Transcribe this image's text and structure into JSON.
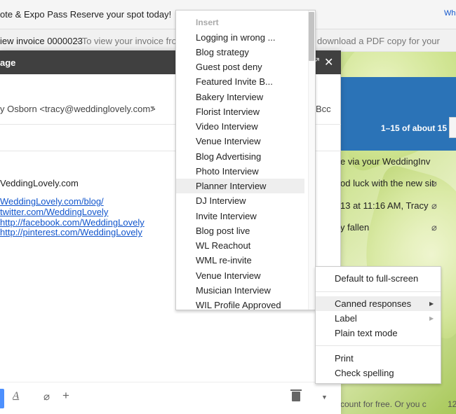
{
  "banner": {
    "text": "ote & Expo Pass Reserve your spot today!",
    "link": "Wh"
  },
  "invoice": {
    "subject": "iew invoice 0000023",
    "snippet": "- To view your invoice fror",
    "snippet_tail": "download a PDF copy for your"
  },
  "inbox": {
    "paging": "1–15 of about 15",
    "rows": [
      "e via your WeddingInv",
      "od luck with the new sit",
      "13 at 11:16 AM, Tracy",
      "y fallen"
    ],
    "bottom_text": "count for free. Or you c",
    "bottom_num": "12"
  },
  "compose": {
    "title": "age",
    "from": "y Osborn <tracy@weddinglovely.com>",
    "bcc": "Bcc",
    "body_line": "VeddingLovely.com",
    "links": [
      "WeddingLovely.com/blog/",
      "twitter.com/WeddingLovely",
      "http://facebook.com/WeddingLovely",
      "http://pinterest.com/WeddingLovely"
    ]
  },
  "insert_menu": {
    "header": "Insert",
    "items": [
      "Logging in wrong ...",
      "Blog strategy",
      "Guest post deny",
      "Featured Invite B...",
      "Bakery Interview",
      "Florist Interview",
      "Video Interview",
      "Venue Interview",
      "Blog Advertising",
      "Photo Interview",
      "Planner Interview",
      "DJ Interview",
      "Invite Interview",
      "Blog post live",
      "WL Reachout",
      "WML re-invite",
      "Venue Interview",
      "Musician Interview",
      "WIL Profile Approved"
    ]
  },
  "more_menu": {
    "full_screen": "Default to full-screen",
    "canned": "Canned responses",
    "label": "Label",
    "plain_text": "Plain text mode",
    "print": "Print",
    "spelling": "Check spelling"
  },
  "colors": {
    "accent": "#4d90fe",
    "link": "#1155cc",
    "header": "#404040"
  }
}
